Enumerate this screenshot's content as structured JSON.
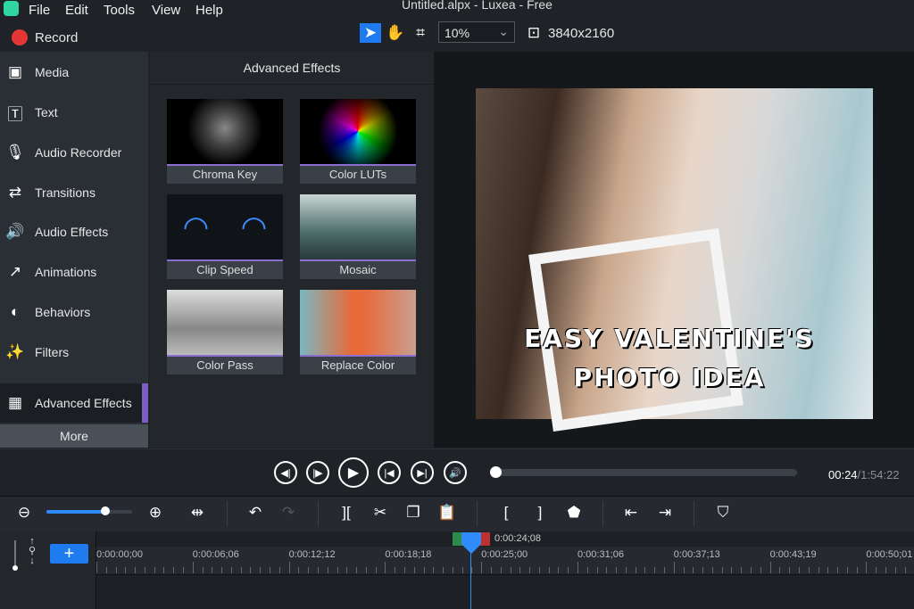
{
  "window": {
    "title": "Untitled.alpx - Luxea - Free"
  },
  "menu": [
    "File",
    "Edit",
    "Tools",
    "View",
    "Help"
  ],
  "record_label": "Record",
  "toolbar_top": {
    "zoom": "10%",
    "resolution": "3840x2160"
  },
  "sidebar": {
    "items": [
      {
        "label": "Media",
        "icon": "media-icon"
      },
      {
        "label": "Text",
        "icon": "text-icon"
      },
      {
        "label": "Audio Recorder",
        "icon": "microphone-icon"
      },
      {
        "label": "Transitions",
        "icon": "transitions-icon"
      },
      {
        "label": "Audio Effects",
        "icon": "speaker-icon"
      },
      {
        "label": "Animations",
        "icon": "arrow-icon"
      },
      {
        "label": "Behaviors",
        "icon": "behaviors-icon"
      },
      {
        "label": "Filters",
        "icon": "wand-icon"
      },
      {
        "label": "Advanced Effects",
        "icon": "advanced-effects-icon"
      }
    ],
    "more": "More"
  },
  "effects": {
    "header": "Advanced Effects",
    "tiles": [
      "Chroma Key",
      "Color LUTs",
      "Clip Speed",
      "Mosaic",
      "Color Pass",
      "Replace Color"
    ]
  },
  "preview": {
    "overlay_line1": "EASY VALENTINE'S",
    "overlay_line2": "PHOTO IDEA"
  },
  "player": {
    "current": "00:24",
    "total": "/1:54:22",
    "progress": 0.0035
  },
  "timeline": {
    "playhead": "0:00:24;08",
    "zoom_level": 0.7,
    "ticks": [
      "0:00:00;00",
      "0:00:06;06",
      "0:00:12;12",
      "0:00:18;18",
      "0:00:25;00",
      "0:00:31;06",
      "0:00:37;13",
      "0:00:43;19",
      "0:00:50;01"
    ]
  }
}
